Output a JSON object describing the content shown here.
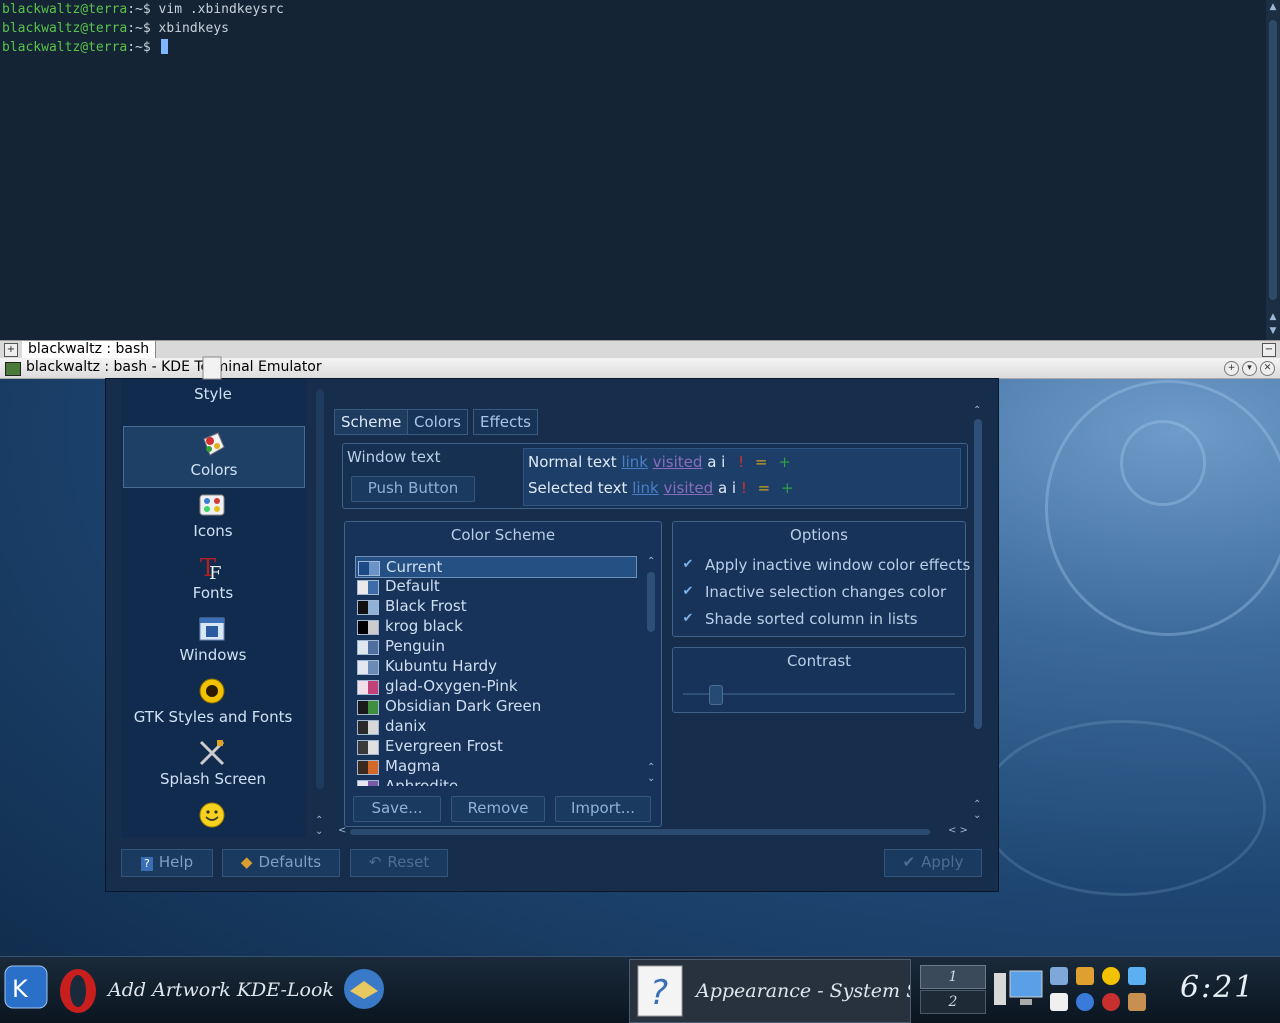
{
  "terminal": {
    "lines": [
      {
        "user": "blackwaltz@terra",
        "rest": ":~$ vim .xbindkeysrc"
      },
      {
        "user": "blackwaltz@terra",
        "rest": ":~$ xbindkeys"
      },
      {
        "user": "blackwaltz@terra",
        "rest": ":~$ "
      }
    ],
    "tab_label": "blackwaltz : bash",
    "window_title": "blackwaltz : bash - KDE Terminal Emulator"
  },
  "settings": {
    "sidebar": {
      "items": [
        {
          "label": "Style",
          "icon": "style-icon"
        },
        {
          "label": "Colors",
          "icon": "colors-icon"
        },
        {
          "label": "Icons",
          "icon": "icons-icon"
        },
        {
          "label": "Fonts",
          "icon": "fonts-icon"
        },
        {
          "label": "Windows",
          "icon": "windows-icon"
        },
        {
          "label": "GTK Styles and Fonts",
          "icon": "gtk-icon"
        },
        {
          "label": "Splash Screen",
          "icon": "splash-screen-icon"
        }
      ],
      "selected": "Colors"
    },
    "tabs": [
      "Scheme",
      "Colors",
      "Effects"
    ],
    "active_tab": "Scheme",
    "preview": {
      "window_text": "Window text",
      "push_button": "Push Button",
      "normal_text": "Normal text",
      "selected_text": "Selected text",
      "link": "link",
      "visited": "visited",
      "suffix": "a i",
      "bang": "!",
      "eq": "=",
      "plus": "+"
    },
    "color_scheme": {
      "title": "Color Scheme",
      "items": [
        {
          "name": "Current",
          "colors": [
            "#1c4a86",
            "#6a93c8"
          ]
        },
        {
          "name": "Default",
          "colors": [
            "#eaeaea",
            "#3d6da8"
          ]
        },
        {
          "name": "Black Frost",
          "colors": [
            "#111111",
            "#8fb2d6"
          ]
        },
        {
          "name": "krog black",
          "colors": [
            "#000000",
            "#cccccc"
          ]
        },
        {
          "name": "Penguin",
          "colors": [
            "#dfe6ee",
            "#4f6f9e"
          ]
        },
        {
          "name": "Kubuntu Hardy",
          "colors": [
            "#e3e8f0",
            "#6a8bb6"
          ]
        },
        {
          "name": "glad-Oxygen-Pink",
          "colors": [
            "#f0dfe8",
            "#c4427a"
          ]
        },
        {
          "name": "Obsidian Dark Green",
          "colors": [
            "#1a1a1a",
            "#3f8f3f"
          ]
        },
        {
          "name": "danix",
          "colors": [
            "#2a2a2a",
            "#d8d8d8"
          ]
        },
        {
          "name": "Evergreen Frost",
          "colors": [
            "#3a3a3a",
            "#e0e0e0"
          ]
        },
        {
          "name": "Magma",
          "colors": [
            "#3a2a20",
            "#d46a2a"
          ]
        },
        {
          "name": "Aphrodite",
          "colors": [
            "#e6e6f0",
            "#7a5aa8"
          ]
        }
      ],
      "save": "Save...",
      "remove": "Remove",
      "import": "Import..."
    },
    "options": {
      "title": "Options",
      "items": [
        "Apply inactive window color effects",
        "Inactive selection changes color",
        "Shade sorted column in lists"
      ]
    },
    "contrast": {
      "title": "Contrast",
      "value": 0.1
    },
    "buttons": {
      "help": "Help",
      "defaults": "Defaults",
      "reset": "Reset",
      "apply": "Apply"
    }
  },
  "taskbar": {
    "tasks": [
      {
        "label": "Add Artwork KDE-Look.org"
      },
      {
        "label": "Appearance - System Settings"
      }
    ],
    "pager": [
      "1",
      "2"
    ],
    "clock": "6:21"
  }
}
